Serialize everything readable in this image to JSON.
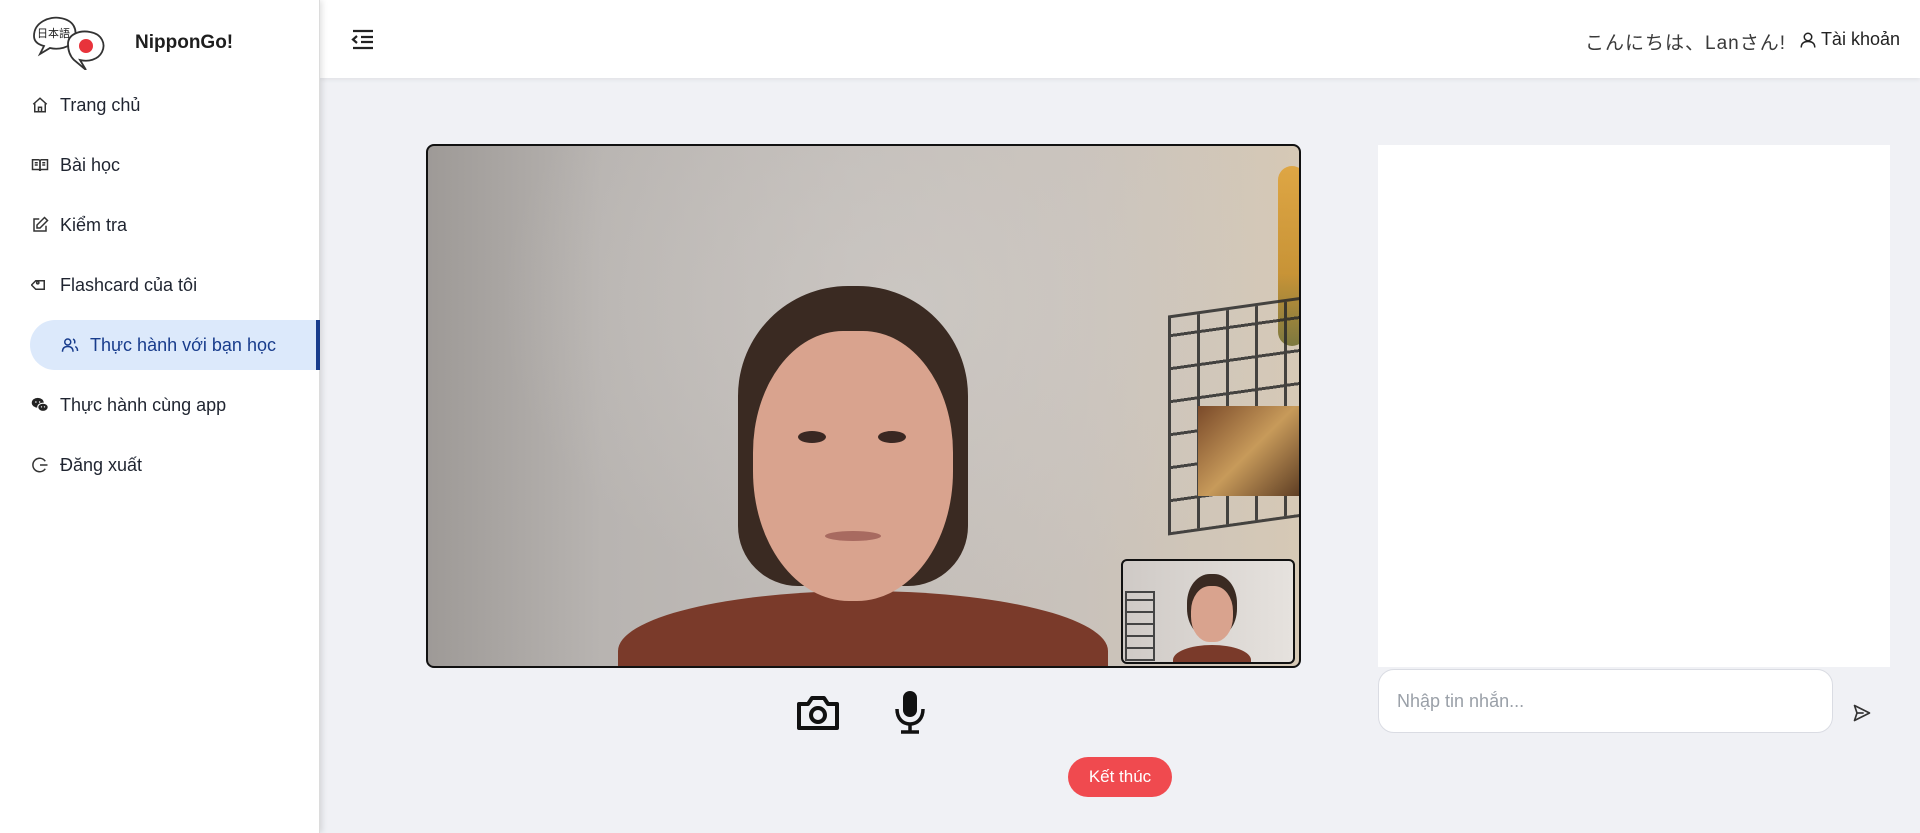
{
  "app": {
    "brand_name": "NipponGo!",
    "logo_text": "日本語"
  },
  "sidebar": {
    "items": [
      {
        "label": "Trang chủ",
        "icon": "home-icon",
        "active": false
      },
      {
        "label": "Bài học",
        "icon": "book-icon",
        "active": false
      },
      {
        "label": "Kiểm tra",
        "icon": "edit-icon",
        "active": false
      },
      {
        "label": "Flashcard của tôi",
        "icon": "tag-icon",
        "active": false
      },
      {
        "label": "Thực hành với bạn học",
        "icon": "users-icon",
        "active": true
      },
      {
        "label": "Thực hành cùng app",
        "icon": "wechat-icon",
        "active": false
      },
      {
        "label": "Đăng xuất",
        "icon": "logout-icon",
        "active": false
      }
    ]
  },
  "header": {
    "greeting": "こんにちは、Lanさん!",
    "account_label": "Tài khoản"
  },
  "video": {
    "end_call_label": "Kết thúc"
  },
  "chat": {
    "input_placeholder": "Nhập tin nhắn..."
  },
  "colors": {
    "accent": "#183c8c",
    "active_bg": "#dce9fb",
    "end_call": "#f04a4f",
    "background": "#f0f1f5"
  }
}
